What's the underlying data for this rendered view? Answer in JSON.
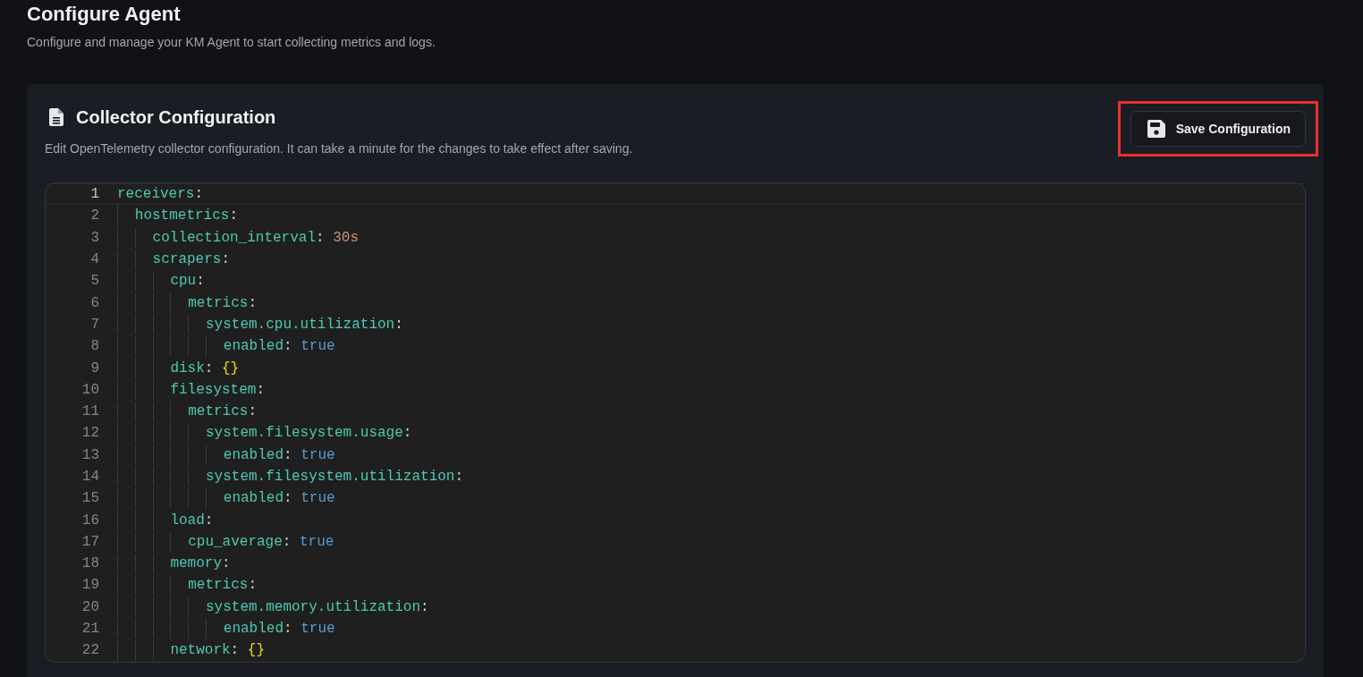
{
  "page": {
    "title": "Configure Agent",
    "subtitle": "Configure and manage your KM Agent to start collecting metrics and logs."
  },
  "card": {
    "title": "Collector Configuration",
    "description": "Edit OpenTelemetry collector configuration. It can take a minute for the changes to take effect after saving.",
    "save_button": {
      "label": "Save Configuration",
      "highlighted": true
    }
  },
  "editor": {
    "lines": [
      {
        "number": "1",
        "key": "receivers",
        "punct": ":",
        "current": true,
        "children": [
          {
            "number": "2",
            "key": "hostmetrics",
            "punct": ":",
            "current": false,
            "children": [
              {
                "number": "3",
                "key": "collection_interval",
                "punct": ":",
                "value": {
                  "text": "30s",
                  "kind": "scalar"
                },
                "current": false
              },
              {
                "number": "4",
                "key": "scrapers",
                "punct": ":",
                "current": false,
                "children": [
                  {
                    "number": "5",
                    "key": "cpu",
                    "punct": ":",
                    "current": false,
                    "children": [
                      {
                        "number": "6",
                        "key": "metrics",
                        "punct": ":",
                        "current": false,
                        "children": [
                          {
                            "number": "7",
                            "key": "system.cpu.utilization",
                            "punct": ":",
                            "current": false,
                            "children": [
                              {
                                "number": "8",
                                "key": "enabled",
                                "punct": ":",
                                "value": {
                                  "text": "true",
                                  "kind": "boolean"
                                },
                                "current": false
                              }
                            ]
                          }
                        ]
                      }
                    ]
                  },
                  {
                    "number": "9",
                    "key": "disk",
                    "punct": ":",
                    "value": {
                      "text": "{}",
                      "kind": "braces"
                    },
                    "current": false
                  },
                  {
                    "number": "10",
                    "key": "filesystem",
                    "punct": ":",
                    "current": false,
                    "children": [
                      {
                        "number": "11",
                        "key": "metrics",
                        "punct": ":",
                        "current": false,
                        "children": [
                          {
                            "number": "12",
                            "key": "system.filesystem.usage",
                            "punct": ":",
                            "current": false,
                            "children": [
                              {
                                "number": "13",
                                "key": "enabled",
                                "punct": ":",
                                "value": {
                                  "text": "true",
                                  "kind": "boolean"
                                },
                                "current": false
                              }
                            ]
                          },
                          {
                            "number": "14",
                            "key": "system.filesystem.utilization",
                            "punct": ":",
                            "current": false,
                            "children": [
                              {
                                "number": "15",
                                "key": "enabled",
                                "punct": ":",
                                "value": {
                                  "text": "true",
                                  "kind": "boolean"
                                },
                                "current": false
                              }
                            ]
                          }
                        ]
                      }
                    ]
                  },
                  {
                    "number": "16",
                    "key": "load",
                    "punct": ":",
                    "current": false,
                    "children": [
                      {
                        "number": "17",
                        "key": "cpu_average",
                        "punct": ":",
                        "value": {
                          "text": "true",
                          "kind": "boolean"
                        },
                        "current": false
                      }
                    ]
                  },
                  {
                    "number": "18",
                    "key": "memory",
                    "punct": ":",
                    "current": false,
                    "children": [
                      {
                        "number": "19",
                        "key": "metrics",
                        "punct": ":",
                        "current": false,
                        "children": [
                          {
                            "number": "20",
                            "key": "system.memory.utilization",
                            "punct": ":",
                            "current": false,
                            "children": [
                              {
                                "number": "21",
                                "key": "enabled",
                                "punct": ":",
                                "value": {
                                  "text": "true",
                                  "kind": "boolean"
                                },
                                "current": false
                              }
                            ]
                          }
                        ]
                      }
                    ]
                  },
                  {
                    "number": "22",
                    "key": "network",
                    "punct": ":",
                    "value": {
                      "text": "{}",
                      "kind": "braces"
                    },
                    "current": false
                  }
                ]
              }
            ]
          }
        ]
      }
    ]
  }
}
